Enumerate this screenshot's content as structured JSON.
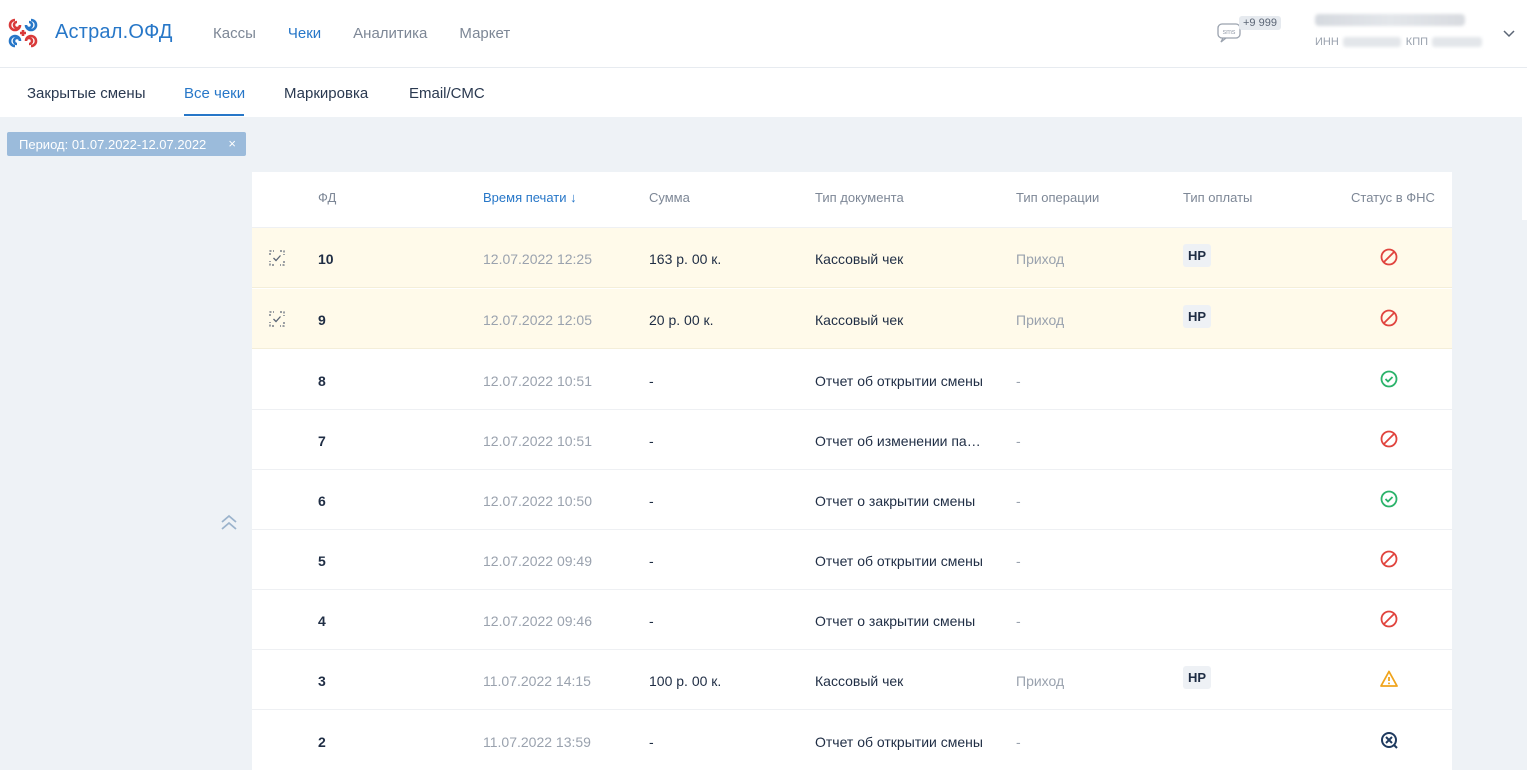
{
  "header": {
    "brand": "Астрал.ОФД",
    "nav": [
      {
        "label": "Кассы",
        "active": false
      },
      {
        "label": "Чеки",
        "active": true
      },
      {
        "label": "Аналитика",
        "active": false
      },
      {
        "label": "Маркет",
        "active": false
      }
    ],
    "sms_badge": "+9 999",
    "org_inn_label": "ИНН",
    "org_kpp_label": "КПП"
  },
  "subnav": {
    "tabs": [
      {
        "label": "Закрытые смены",
        "active": false
      },
      {
        "label": "Все чеки",
        "active": true
      },
      {
        "label": "Маркировка",
        "active": false
      },
      {
        "label": "Email/СМС",
        "active": false
      }
    ]
  },
  "filter": {
    "chip_label": "Период: 01.07.2022-12.07.2022",
    "close_glyph": "×"
  },
  "table": {
    "columns": {
      "fd": "ФД",
      "time": "Время печати",
      "sort_glyph": "↓",
      "sum": "Сумма",
      "doc_type": "Тип документа",
      "op_type": "Тип операции",
      "pay_type": "Тип оплаты",
      "status": "Статус в ФНС"
    },
    "rows": [
      {
        "fd": "10",
        "time": "12.07.2022 12:25",
        "sum": "163 р. 00 к.",
        "doc": "Кассовый чек",
        "op": "Приход",
        "pay": "НР",
        "status": "rejected",
        "highlight": true
      },
      {
        "fd": "9",
        "time": "12.07.2022 12:05",
        "sum": "20 р. 00 к.",
        "doc": "Кассовый чек",
        "op": "Приход",
        "pay": "НР",
        "status": "rejected",
        "highlight": true
      },
      {
        "fd": "8",
        "time": "12.07.2022 10:51",
        "sum": "-",
        "doc": "Отчет об открытии смены",
        "op": "-",
        "pay": "",
        "status": "accepted",
        "highlight": false
      },
      {
        "fd": "7",
        "time": "12.07.2022 10:51",
        "sum": "-",
        "doc": "Отчет об изменении параметров",
        "op": "-",
        "pay": "",
        "status": "rejected",
        "highlight": false
      },
      {
        "fd": "6",
        "time": "12.07.2022 10:50",
        "sum": "-",
        "doc": "Отчет о закрытии смены",
        "op": "-",
        "pay": "",
        "status": "accepted",
        "highlight": false
      },
      {
        "fd": "5",
        "time": "12.07.2022 09:49",
        "sum": "-",
        "doc": "Отчет об открытии смены",
        "op": "-",
        "pay": "",
        "status": "rejected",
        "highlight": false
      },
      {
        "fd": "4",
        "time": "12.07.2022 09:46",
        "sum": "-",
        "doc": "Отчет о закрытии смены",
        "op": "-",
        "pay": "",
        "status": "rejected",
        "highlight": false
      },
      {
        "fd": "3",
        "time": "11.07.2022 14:15",
        "sum": "100 р. 00 к.",
        "doc": "Кассовый чек",
        "op": "Приход",
        "pay": "НР",
        "status": "warning",
        "highlight": false
      },
      {
        "fd": "2",
        "time": "11.07.2022 13:59",
        "sum": "-",
        "doc": "Отчет об открытии смены",
        "op": "-",
        "pay": "",
        "status": "error",
        "highlight": false
      }
    ]
  },
  "colors": {
    "accent": "#2777c8",
    "rejected": "#e0443e",
    "accepted": "#2bb36b",
    "warning": "#f0a41c",
    "error": "#1f3a5f",
    "highlight_row": "#fffaea"
  }
}
